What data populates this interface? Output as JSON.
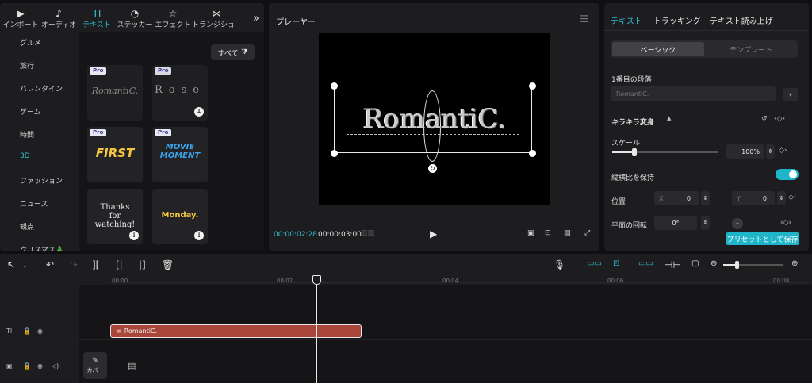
{
  "tabs": [
    {
      "icon": "▶",
      "label": "インポート"
    },
    {
      "icon": "♪",
      "label": "オーディオ"
    },
    {
      "icon": "TI",
      "label": "テキスト"
    },
    {
      "icon": "◔",
      "label": "ステッカー"
    },
    {
      "icon": "☆",
      "label": "エフェクト"
    },
    {
      "icon": "⋈",
      "label": "トランジション"
    }
  ],
  "tab_more": "»",
  "categories": [
    "グルメ",
    "旅行",
    "バレンタイン",
    "ゲーム",
    "時間",
    "3D",
    "ファッション",
    "ニュース",
    "観点",
    "クリスマス🎄"
  ],
  "filter_label": "すべて",
  "tiles": [
    {
      "pro": "Pro",
      "text": "RomantiC."
    },
    {
      "pro": "Pro",
      "text": "Rose"
    },
    {
      "pro": "Pro",
      "text": "FIRST"
    },
    {
      "pro": "Pro",
      "text": "MOVIE MOMENT"
    },
    {
      "pro": "",
      "text": "Thanks for watching!"
    },
    {
      "pro": "",
      "text": "Monday."
    }
  ],
  "player": {
    "title": "プレーヤー",
    "preview_text": "RomantiC.",
    "time_current": "00:00:02:28",
    "time_total": "00:00:03:00"
  },
  "inspector": {
    "tabs": [
      "テキスト",
      "トラッキング",
      "テキスト読み上げ"
    ],
    "seg_basic": "ベーシック",
    "seg_template": "テンプレート",
    "paragraph_label": "1番目の段落",
    "paragraph_text": "RomantiC.",
    "effect_label": "キラキラ変身",
    "scale_label": "スケール",
    "scale_value": "100%",
    "aspect_label": "縦横比を保持",
    "position_label": "位置",
    "x_label": "X",
    "x_value": "0",
    "y_label": "Y",
    "y_value": "0",
    "rotation_label": "平面の回転",
    "rotation_value": "0°",
    "save_preset": "プリセットとして保存"
  },
  "timeline": {
    "ticks": [
      "00:00",
      "00:02",
      "00:04",
      "00:06",
      "00:08"
    ],
    "clip_label": "RomantiC.",
    "cover_label": "カバー"
  },
  "colors": {
    "accent": "#2fc2d4",
    "clip": "#a9463a"
  }
}
